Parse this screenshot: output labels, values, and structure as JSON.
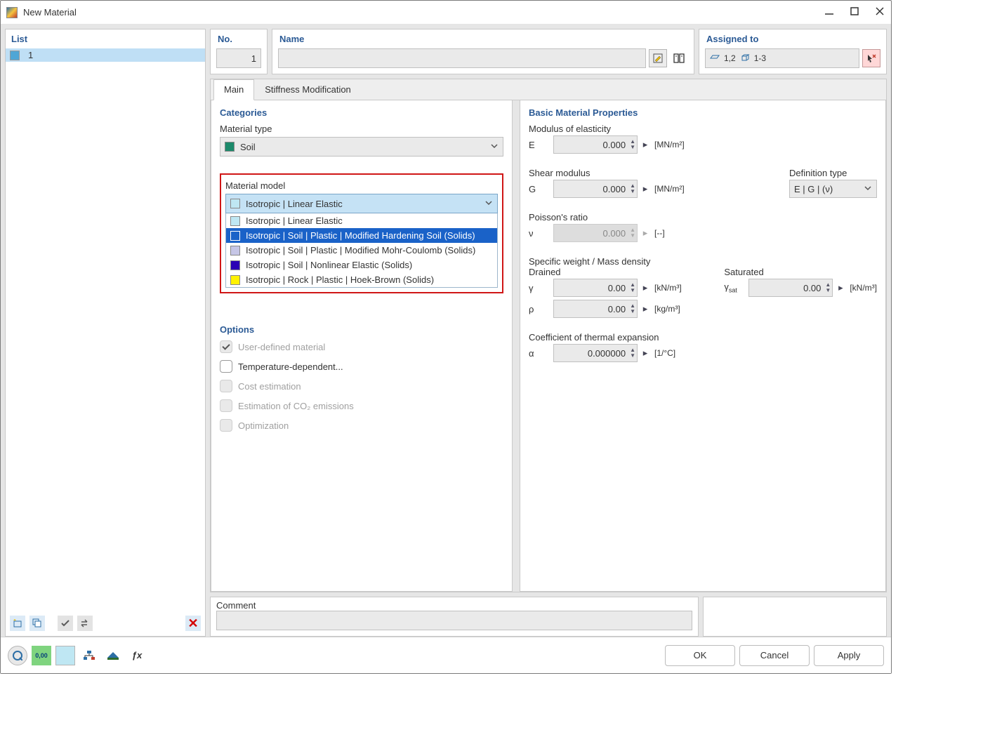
{
  "window": {
    "title": "New Material"
  },
  "list": {
    "title": "List",
    "item_no": "1"
  },
  "number_panel": {
    "title": "No.",
    "value": "1"
  },
  "name_panel": {
    "title": "Name",
    "value": ""
  },
  "assigned_panel": {
    "title": "Assigned to",
    "surface_range": "1,2",
    "solid_range": "1-3"
  },
  "tabs": {
    "main": "Main",
    "stiffness": "Stiffness Modification"
  },
  "categories": {
    "title": "Categories",
    "material_type_label": "Material type",
    "material_type_value": "Soil",
    "material_type_color": "#1c8a6b",
    "material_model_label": "Material model",
    "material_model_selected": "Isotropic | Linear Elastic",
    "model_options": [
      {
        "color": "#bfe7f3",
        "label": "Isotropic | Linear Elastic"
      },
      {
        "color": "#1a62c8",
        "label": "Isotropic | Soil | Plastic | Modified Hardening Soil (Solids)"
      },
      {
        "color": "#c6c6e6",
        "label": "Isotropic | Soil | Plastic | Modified Mohr-Coulomb (Solids)"
      },
      {
        "color": "#2a00b5",
        "label": "Isotropic | Soil | Nonlinear Elastic (Solids)"
      },
      {
        "color": "#fff200",
        "label": "Isotropic | Rock | Plastic | Hoek-Brown (Solids)"
      }
    ]
  },
  "options": {
    "title": "Options",
    "user_defined": "User-defined material",
    "temperature": "Temperature-dependent...",
    "cost": "Cost estimation",
    "co2": "Estimation of CO₂ emissions",
    "optimization": "Optimization"
  },
  "props": {
    "title": "Basic Material Properties",
    "modulus_label": "Modulus of elasticity",
    "E_sym": "E",
    "E_val": "0.000",
    "E_unit": "[MN/m²]",
    "shear_label": "Shear modulus",
    "G_sym": "G",
    "G_val": "0.000",
    "G_unit": "[MN/m²]",
    "deftype_label": "Definition type",
    "deftype_val": "E | G | (ν)",
    "poisson_label": "Poisson's ratio",
    "nu_sym": "ν",
    "nu_val": "0.000",
    "nu_unit": "[--]",
    "specific_label": "Specific weight / Mass density",
    "drained_label": "Drained",
    "saturated_label": "Saturated",
    "gamma_sym": "γ",
    "gamma_val": "0.00",
    "gamma_unit": "[kN/m³]",
    "gammasat_sym": "γ",
    "gammasat_sub": "sat",
    "gammasat_val": "0.00",
    "gammasat_unit": "[kN/m³]",
    "rho_sym": "ρ",
    "rho_val": "0.00",
    "rho_unit": "[kg/m³]",
    "expansion_label": "Coefficient of thermal expansion",
    "alpha_sym": "α",
    "alpha_val": "0.000000",
    "alpha_unit": "[1/°C]"
  },
  "comment": {
    "title": "Comment",
    "value": ""
  },
  "buttons": {
    "ok": "OK",
    "cancel": "Cancel",
    "apply": "Apply"
  }
}
